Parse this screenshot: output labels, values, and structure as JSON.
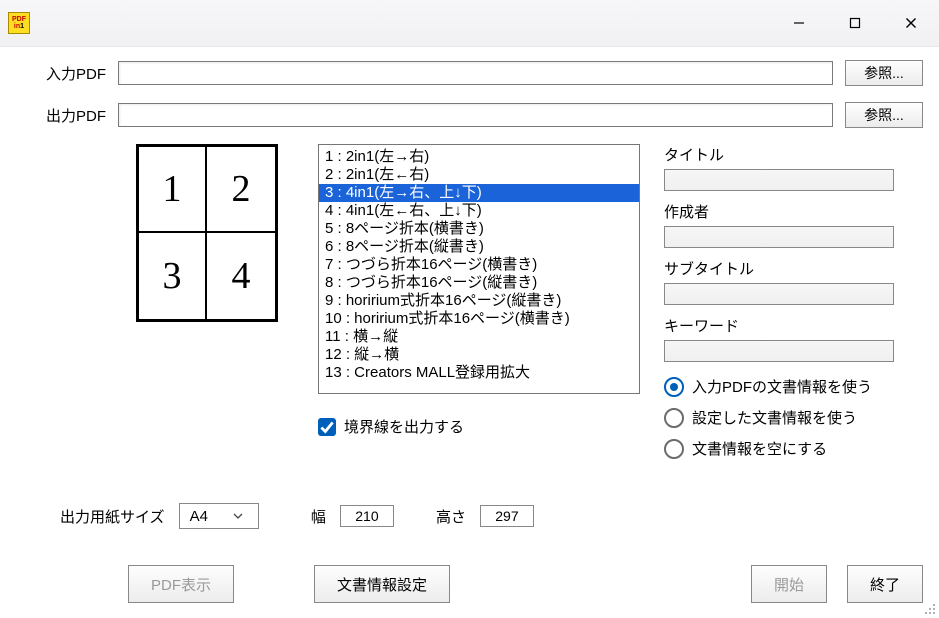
{
  "labels": {
    "input_pdf": "入力PDF",
    "output_pdf": "出力PDF",
    "browse": "参照...",
    "title": "タイトル",
    "author": "作成者",
    "subtitle": "サブタイトル",
    "keywords": "キーワード",
    "border_output": "境界線を出力する",
    "paper_size": "出力用紙サイズ",
    "width": "幅",
    "height": "高さ",
    "pdf_view": "PDF表示",
    "docinfo_set": "文書情報設定",
    "start": "開始",
    "exit": "終了"
  },
  "fields": {
    "input_pdf": "",
    "output_pdf": "",
    "title": "",
    "author": "",
    "subtitle": "",
    "keywords": ""
  },
  "preview_cells": [
    "1",
    "2",
    "3",
    "4"
  ],
  "layout_options": [
    "1 : 2in1(左→右)",
    "2 : 2in1(左←右)",
    "3 : 4in1(左→右、上↓下)",
    "4 : 4in1(左←右、上↓下)",
    "5 : 8ページ折本(横書き)",
    "6 : 8ページ折本(縦書き)",
    "7 : つづら折本16ページ(横書き)",
    "8 : つづら折本16ページ(縦書き)",
    "9 : horirium式折本16ページ(縦書き)",
    "10 : horirium式折本16ページ(横書き)",
    "11 : 横→縦",
    "12 : 縦→横",
    "13 : Creators MALL登録用拡大"
  ],
  "layout_selected_index": 2,
  "docinfo_radios": [
    "入力PDFの文書情報を使う",
    "設定した文書情報を使う",
    "文書情報を空にする"
  ],
  "docinfo_selected_index": 0,
  "border_checked": true,
  "paper": {
    "size": "A4",
    "width": "210",
    "height": "297"
  }
}
